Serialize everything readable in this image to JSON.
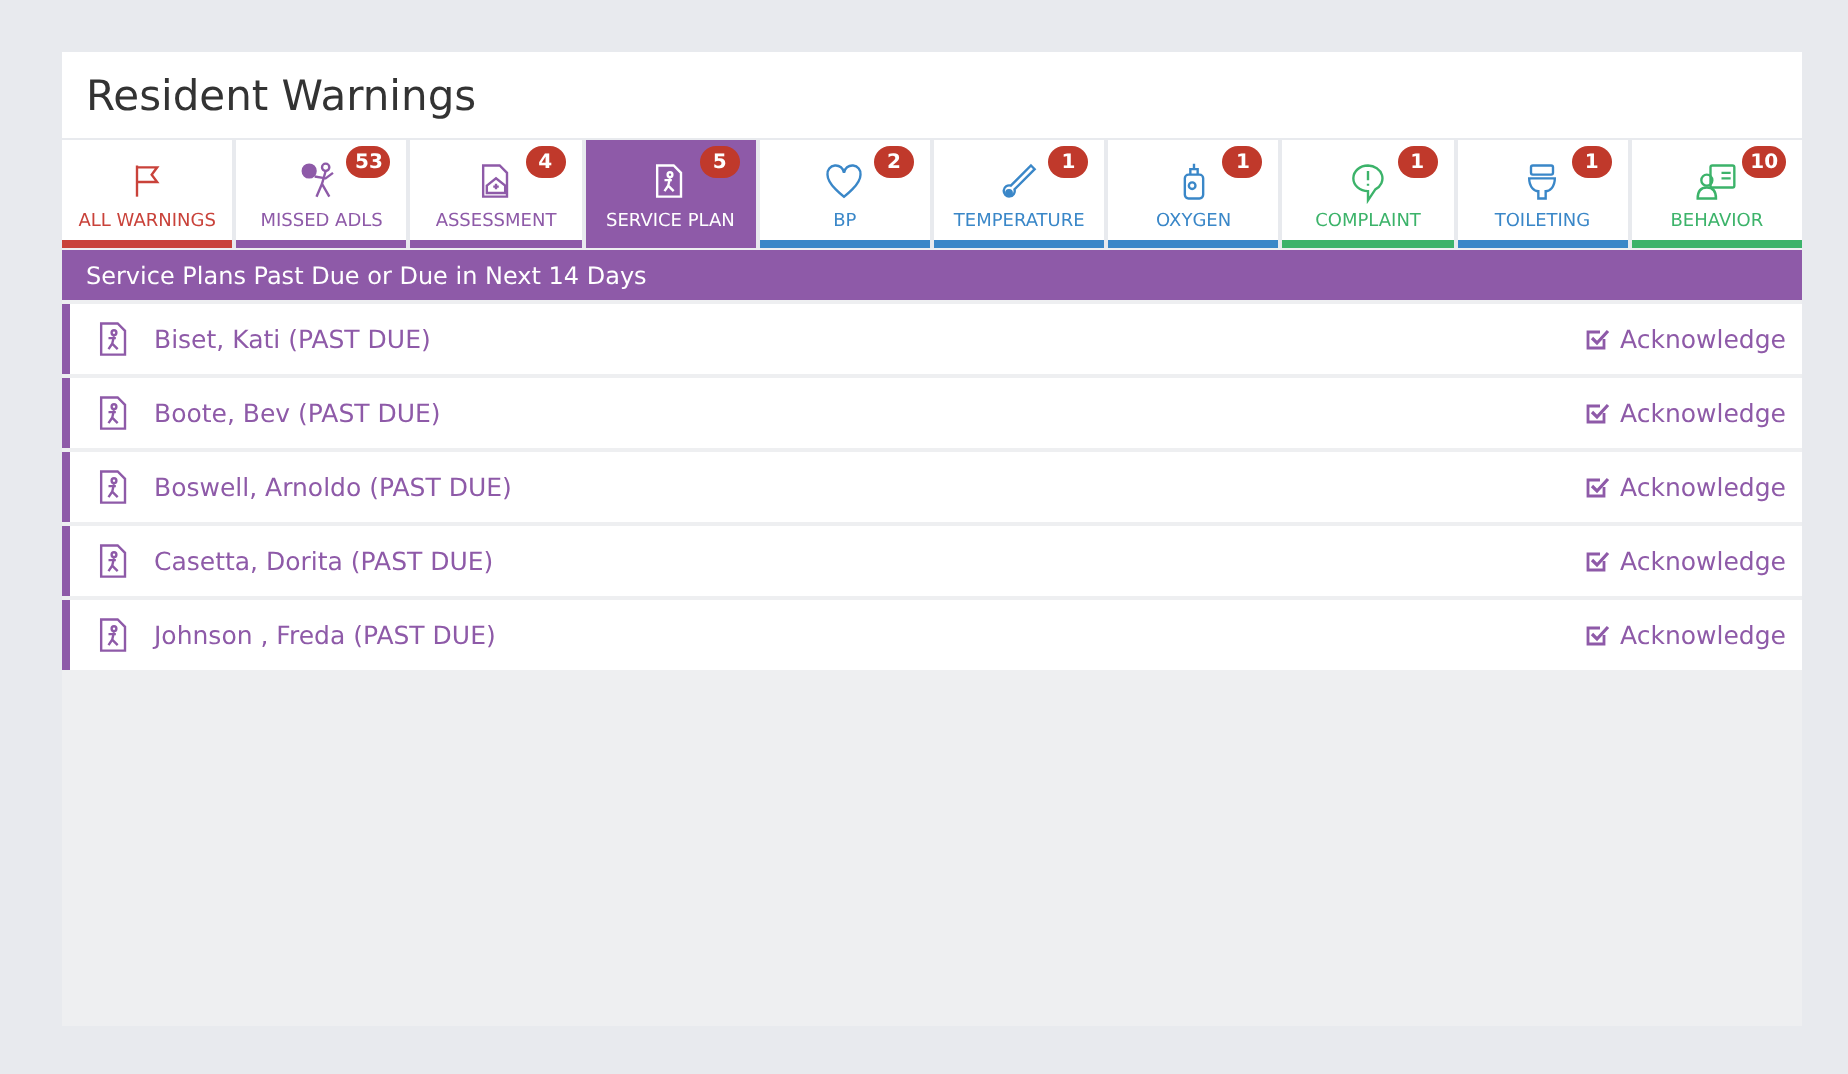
{
  "title": "Resident Warnings",
  "tabs": [
    {
      "label": "ALL WARNINGS",
      "kind": "flag",
      "color": "#c9423a",
      "selected": false
    },
    {
      "label": "MISSED ADLS",
      "kind": "adls",
      "color": "#8e5aa8",
      "badge": "53",
      "selected": false
    },
    {
      "label": "ASSESSMENT",
      "kind": "assessment",
      "color": "#8e5aa8",
      "badge": "4",
      "selected": false
    },
    {
      "label": "SERVICE PLAN",
      "kind": "plan",
      "color": "#8e5aa8",
      "badge": "5",
      "selected": true
    },
    {
      "label": "BP",
      "kind": "heart",
      "color": "#3a87c8",
      "badge": "2",
      "selected": false
    },
    {
      "label": "TEMPERATURE",
      "kind": "thermometer",
      "color": "#3a87c8",
      "badge": "1",
      "selected": false
    },
    {
      "label": "OXYGEN",
      "kind": "oxygen",
      "color": "#3a87c8",
      "badge": "1",
      "selected": false
    },
    {
      "label": "COMPLAINT",
      "kind": "complaint",
      "color": "#3cb36a",
      "badge": "1",
      "selected": false
    },
    {
      "label": "TOILETING",
      "kind": "toilet",
      "color": "#3a87c8",
      "badge": "1",
      "selected": false
    },
    {
      "label": "BEHAVIOR",
      "kind": "behavior",
      "color": "#3cb36a",
      "badge": "10",
      "selected": false
    }
  ],
  "section": {
    "title": "Service Plans Past Due or Due in Next 14 Days"
  },
  "rows": [
    {
      "name": "Biset, Kati (PAST DUE)",
      "action": "Acknowledge"
    },
    {
      "name": "Boote, Bev (PAST DUE)",
      "action": "Acknowledge"
    },
    {
      "name": "Boswell, Arnoldo (PAST DUE)",
      "action": "Acknowledge"
    },
    {
      "name": "Casetta, Dorita (PAST DUE)",
      "action": "Acknowledge"
    },
    {
      "name": "Johnson , Freda (PAST DUE)",
      "action": "Acknowledge"
    }
  ]
}
